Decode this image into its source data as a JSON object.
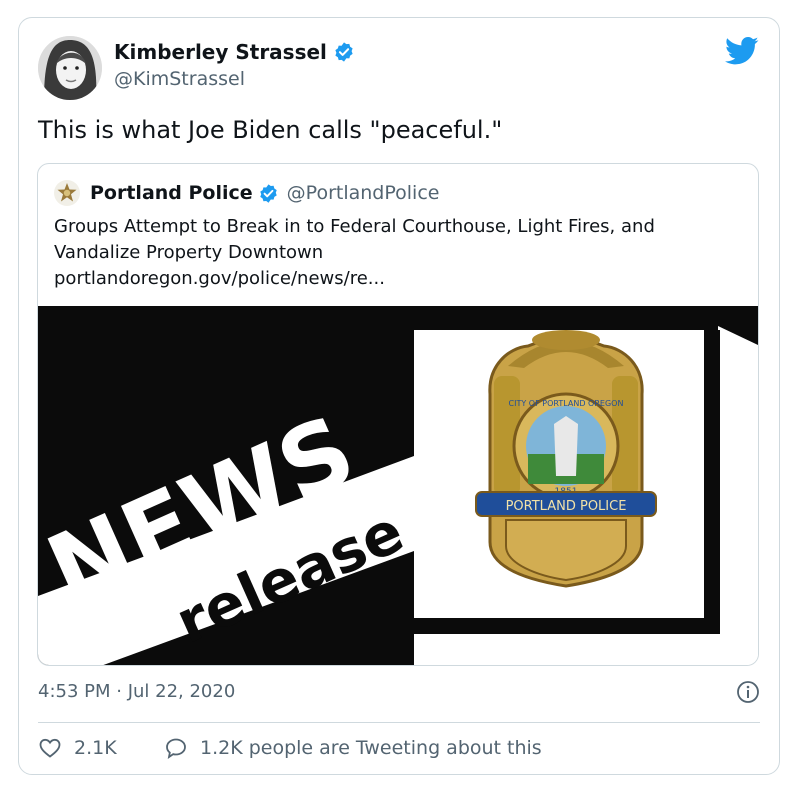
{
  "author": {
    "name": "Kimberley Strassel",
    "handle": "@KimStrassel"
  },
  "tweet": {
    "text": "This is what Joe Biden calls \"peaceful.\"",
    "timestamp": "4:53 PM · Jul 22, 2020"
  },
  "quoted": {
    "name": "Portland Police",
    "handle": "@PortlandPolice",
    "text": "Groups Attempt to Break in to Federal Courthouse, Light Fires, and Vandalize Property Downtown",
    "link": "portlandoregon.gov/police/news/re...",
    "image": {
      "headline": "NEWS",
      "subhead": "release",
      "badge_seal_text": "CITY OF PORTLAND OREGON",
      "badge_year": "1851",
      "badge_banner": "PORTLAND POLICE"
    }
  },
  "actions": {
    "likes": "2.1K",
    "tweeting": "1.2K people are Tweeting about this"
  },
  "colors": {
    "twitter_blue": "#1d9bf0",
    "muted": "#536471",
    "border": "#cfd9de",
    "badge_gold": "#c9a347",
    "badge_blue": "#1f4e9a"
  },
  "icons": [
    "twitter-bird-icon",
    "verified-icon",
    "info-icon",
    "heart-icon",
    "speech-bubble-icon"
  ]
}
